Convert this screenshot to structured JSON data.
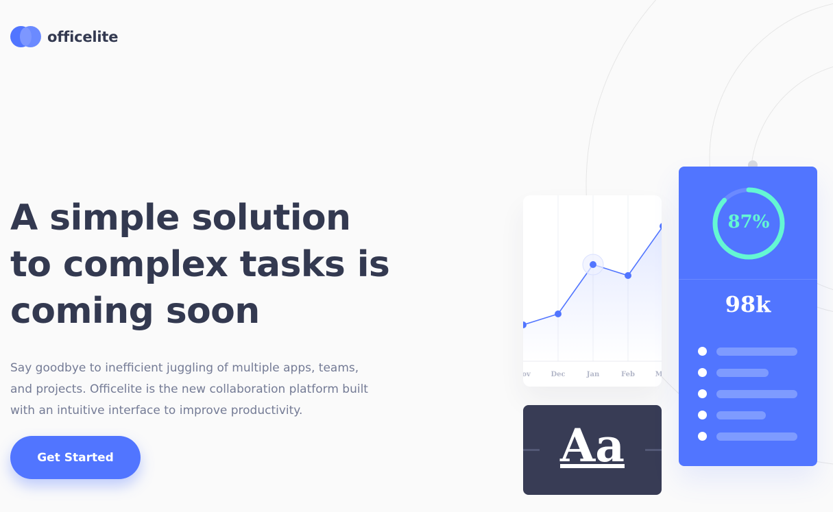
{
  "brand": {
    "name": "officelite",
    "primary": "#5175ff",
    "dark": "#333950",
    "accent": "#64f7d3"
  },
  "hero": {
    "title": "A simple solution to complex tasks is coming soon",
    "description": "Say goodbye to inefficient juggling of multiple apps, teams, and projects. Officelite is the new collaboration platform built with an intuitive interface to improve productivity.",
    "cta_label": "Get Started"
  },
  "chart_card": {
    "chart_data": {
      "type": "line",
      "categories": [
        "Nov",
        "Dec",
        "Jan",
        "Feb",
        "Mar"
      ],
      "series": [
        {
          "values": [
            1,
            2,
            6.5,
            5.5,
            10
          ]
        }
      ],
      "highlight_category": "Jan",
      "grid": true
    }
  },
  "typography_card": {
    "sample": "Aa"
  },
  "stats_card": {
    "progress_label": "87%",
    "progress_value": 0.87,
    "count_label": "98k",
    "list_items": [
      {
        "bar_fraction": 1.0
      },
      {
        "bar_fraction": 0.64
      },
      {
        "bar_fraction": 1.0
      },
      {
        "bar_fraction": 0.61
      },
      {
        "bar_fraction": 1.0
      }
    ]
  }
}
